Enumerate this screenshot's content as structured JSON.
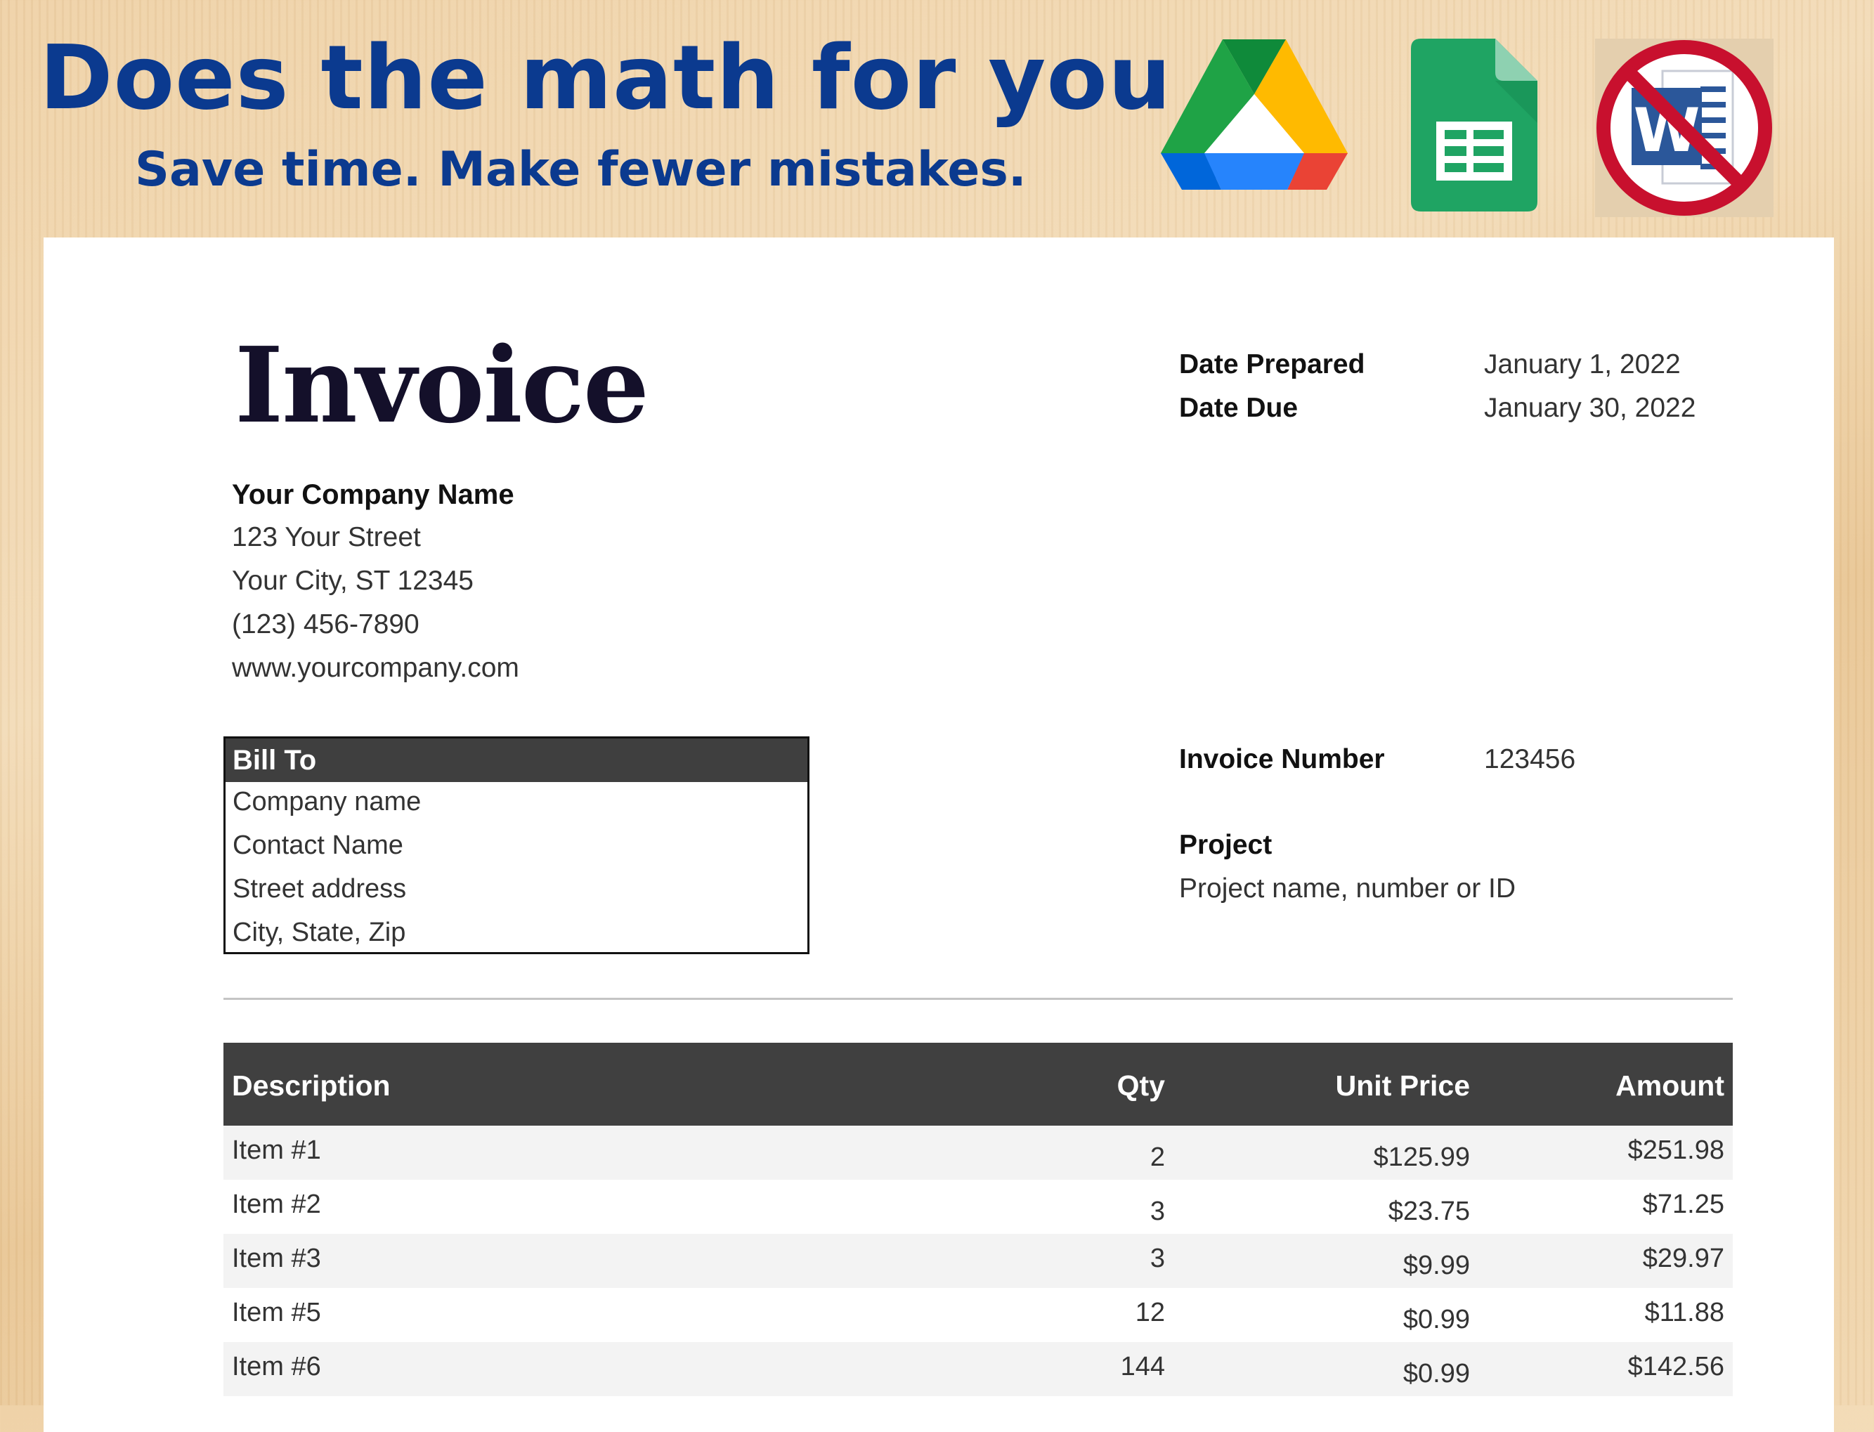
{
  "banner": {
    "headline": "Does the math for you",
    "subheadline": "Save time. Make fewer mistakes."
  },
  "icons": {
    "drive": "google-drive-logo",
    "sheets": "google-sheets-logo",
    "no_word": "no-microsoft-word-icon"
  },
  "colors": {
    "banner_text": "#0b3a8f",
    "header_fill": "#404040",
    "no_sign_red": "#c8102e"
  },
  "invoice": {
    "title": "Invoice",
    "dates": {
      "prepared_label": "Date Prepared",
      "prepared_value": "January 1, 2022",
      "due_label": "Date Due",
      "due_value": "January 30, 2022"
    },
    "company": {
      "name": "Your Company Name",
      "street": "123 Your Street",
      "city": "Your City, ST 12345",
      "phone": "(123) 456-7890",
      "website": "www.yourcompany.com"
    },
    "bill_to": {
      "heading": "Bill To",
      "company": "Company name",
      "contact": "Contact Name",
      "street": "Street address",
      "city": "City, State, Zip"
    },
    "invoice_number_label": "Invoice Number",
    "invoice_number_value": "123456",
    "project_label": "Project",
    "project_value": "Project name, number or ID",
    "table": {
      "headers": {
        "description": "Description",
        "qty": "Qty",
        "unit_price": "Unit Price",
        "amount": "Amount"
      },
      "rows": [
        {
          "description": "Item #1",
          "qty": "2",
          "unit_price": "$125.99",
          "amount": "$251.98"
        },
        {
          "description": "Item #2",
          "qty": "3",
          "unit_price": "$23.75",
          "amount": "$71.25"
        },
        {
          "description": "Item #3",
          "qty": "3",
          "unit_price": "$9.99",
          "amount": "$29.97"
        },
        {
          "description": "Item #5",
          "qty": "12",
          "unit_price": "$0.99",
          "amount": "$11.88"
        },
        {
          "description": "Item #6",
          "qty": "144",
          "unit_price": "$0.99",
          "amount": "$142.56"
        }
      ]
    }
  }
}
